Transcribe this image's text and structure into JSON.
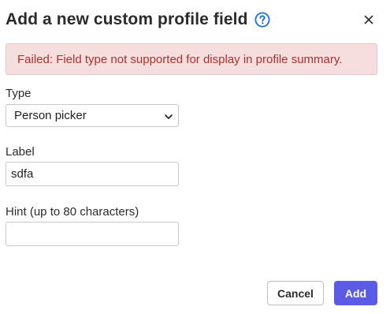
{
  "dialog": {
    "title": "Add a new custom profile field"
  },
  "alert": {
    "message": "Failed: Field type not supported for display in profile summary."
  },
  "form": {
    "type_label": "Type",
    "type_value": "Person picker",
    "label_label": "Label",
    "label_value": "sdfa",
    "hint_label": "Hint (up to 80 characters)",
    "hint_value": ""
  },
  "buttons": {
    "cancel_label": "Cancel",
    "add_label": "Add"
  },
  "icons": {
    "help": "question-circle-icon",
    "close": "close-icon",
    "select_chevron": "chevron-down-icon"
  },
  "colors": {
    "accent": "#5b5be6",
    "help_icon": "#1a6fd6",
    "alert_background": "#f6dede",
    "alert_text": "#a8322f"
  }
}
